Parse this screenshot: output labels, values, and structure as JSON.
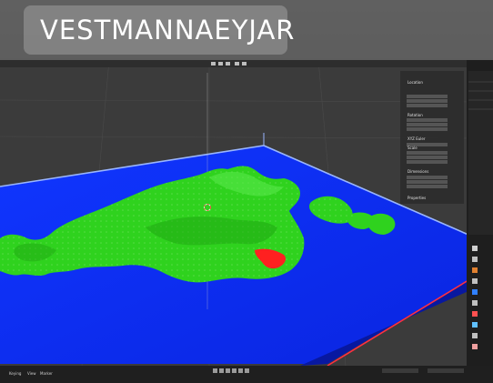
{
  "location": {
    "label": "VESTMANNAEYJAR",
    "icon": "map-pin-icon",
    "badge_color": "#8c8c8c"
  },
  "blender": {
    "transform_panel": {
      "location": "Location",
      "rotation": "Rotation",
      "xyz_euler": "XYZ Euler",
      "scale": "Scale",
      "dimensions": "Dimensions",
      "properties": "Properties"
    },
    "timeline": {
      "keying": "Keying",
      "view": "View",
      "marker": "Marker"
    }
  },
  "colors": {
    "ocean": "#0b2fff",
    "land": "#2fd21e",
    "lava": "#ff2020",
    "edge_top": "#8fb0ff",
    "edge_side": "#ff3040"
  }
}
